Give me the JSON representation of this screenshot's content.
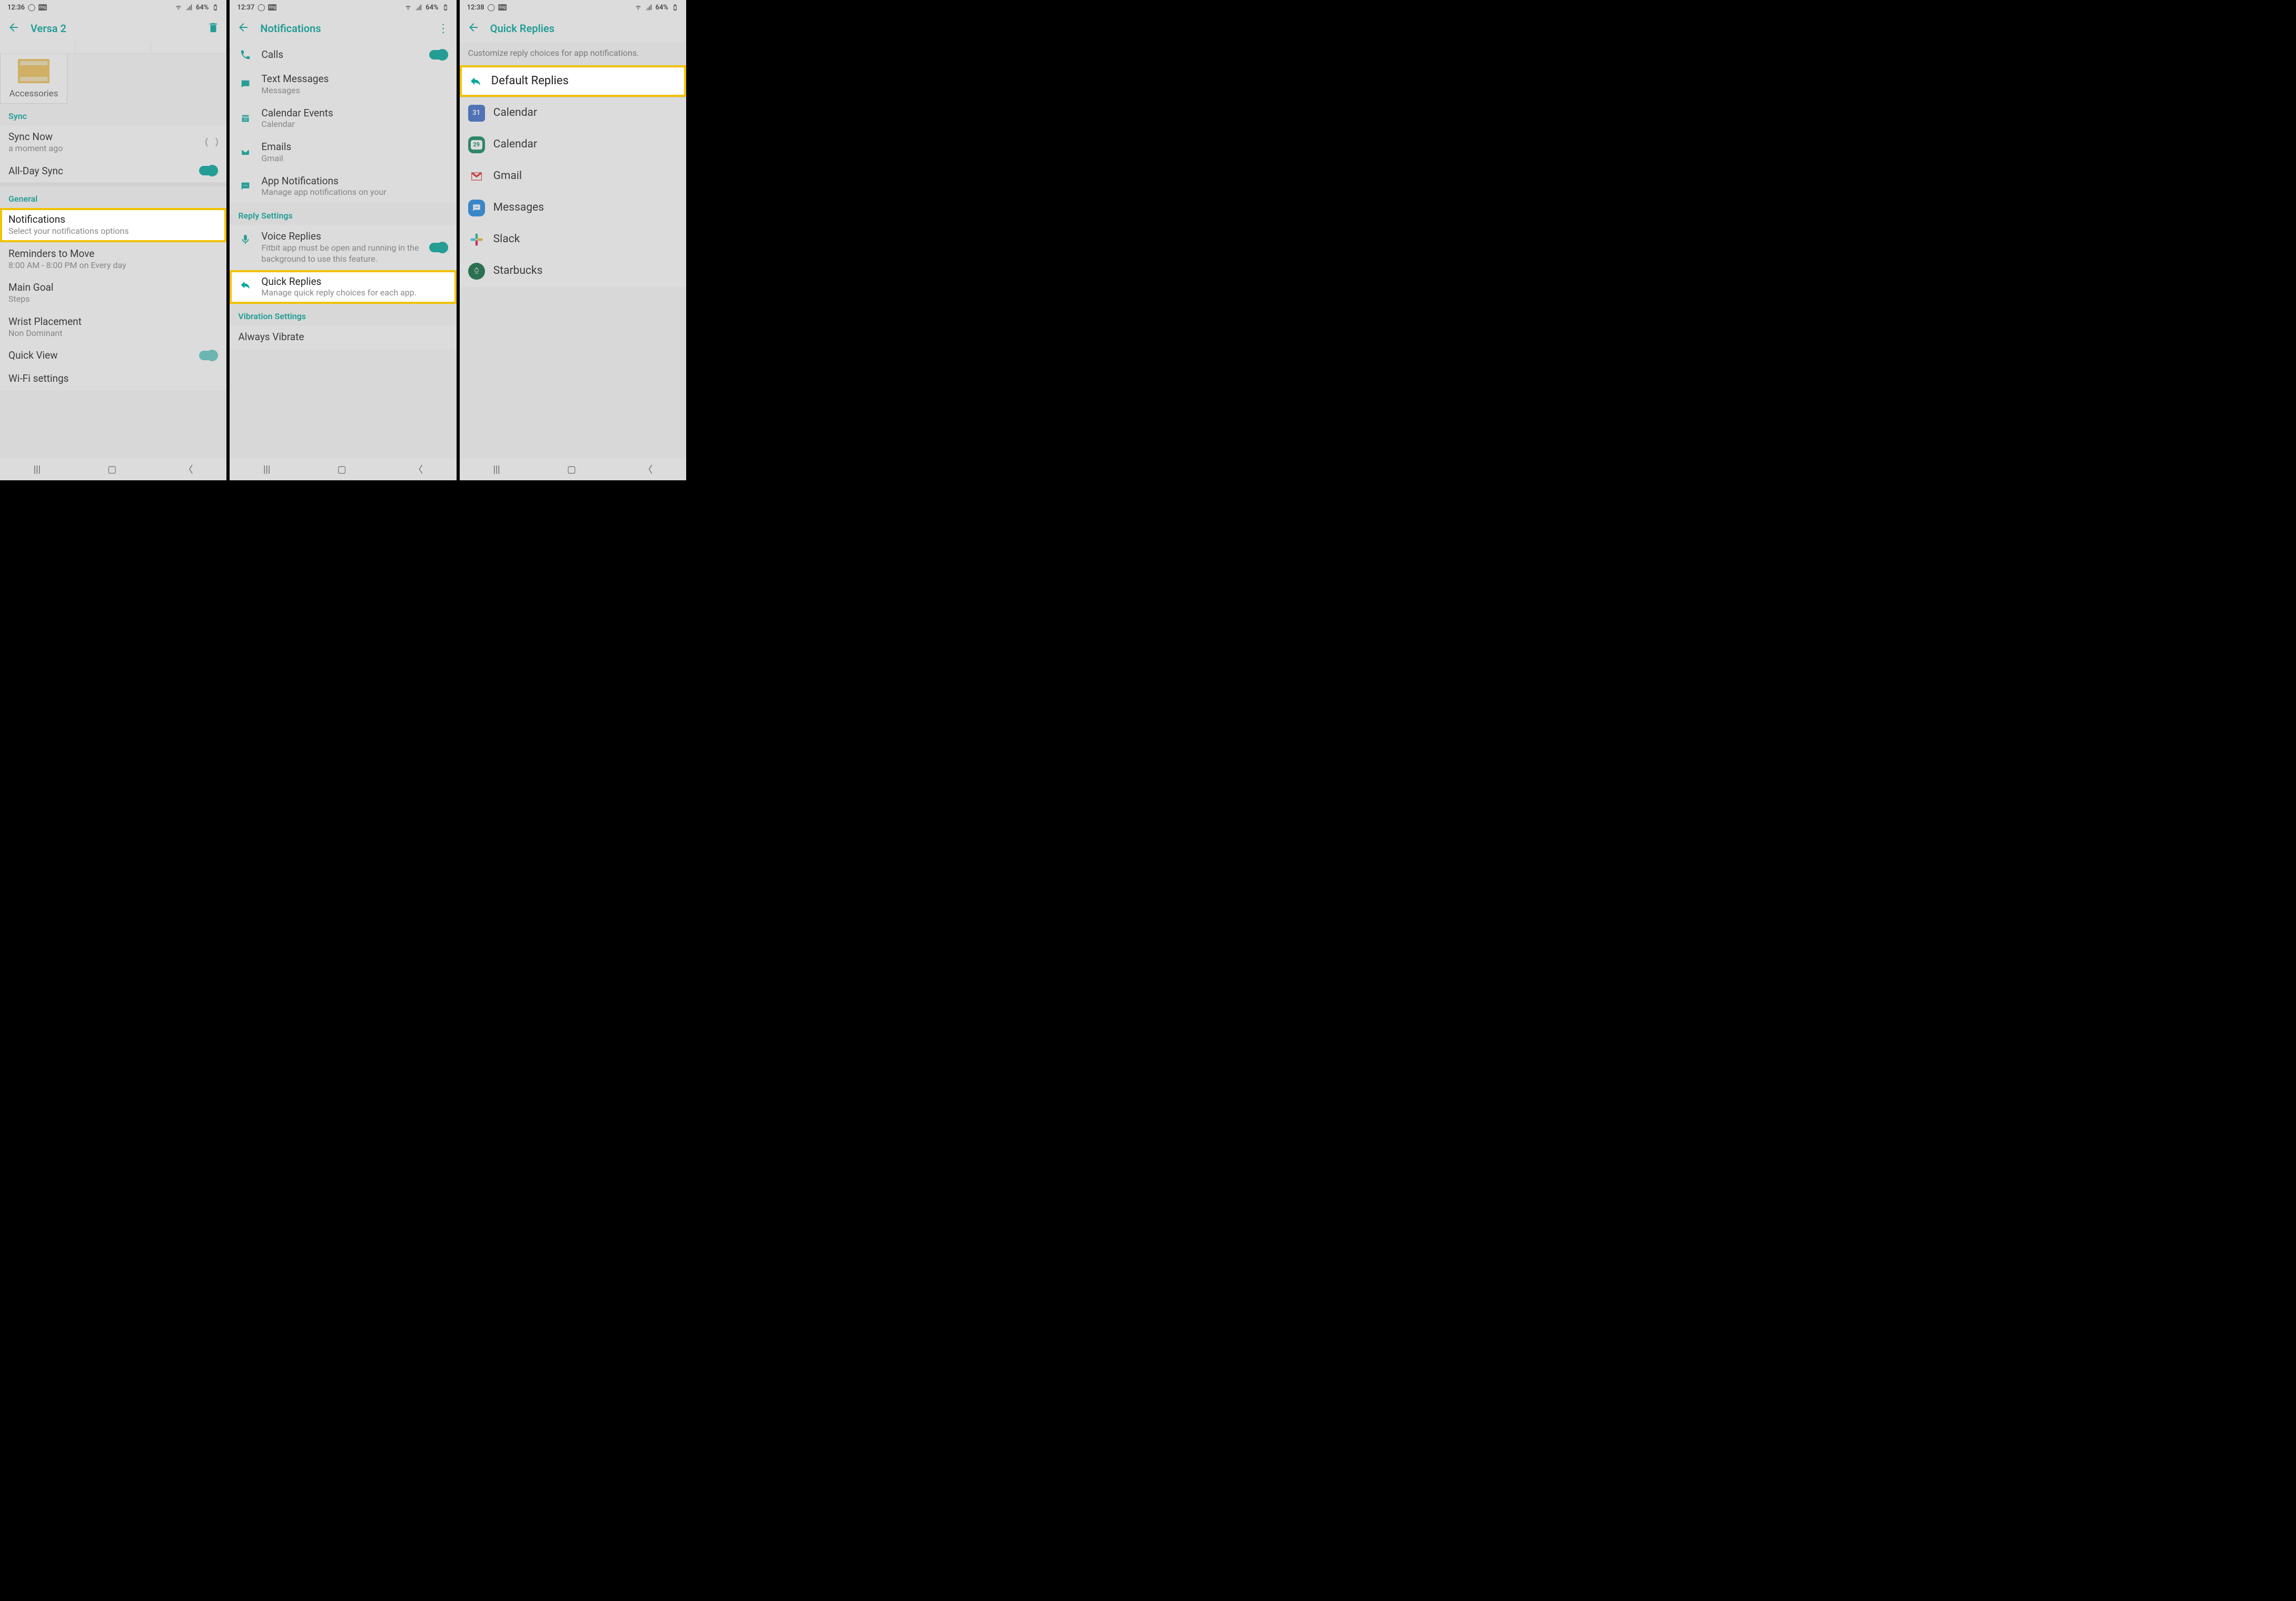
{
  "screens": [
    {
      "status": {
        "time": "12:36",
        "battery": "64%"
      },
      "title": "Versa 2",
      "accessories_label": "Accessories",
      "sections": {
        "sync": {
          "header": "Sync",
          "sync_now": "Sync Now",
          "sync_sub": "a moment ago",
          "allday": "All-Day Sync"
        },
        "general": {
          "header": "General",
          "items": [
            {
              "label": "Notifications",
              "sub": "Select your notifications options",
              "highlight": true
            },
            {
              "label": "Reminders to Move",
              "sub": "8:00 AM - 8:00 PM on Every day"
            },
            {
              "label": "Main Goal",
              "sub": "Steps"
            },
            {
              "label": "Wrist Placement",
              "sub": "Non Dominant"
            },
            {
              "label": "Quick View",
              "toggle": true
            },
            {
              "label": "Wi-Fi settings"
            }
          ]
        }
      }
    },
    {
      "status": {
        "time": "12:37",
        "battery": "64%"
      },
      "title": "Notifications",
      "notif_items": [
        {
          "label": "Calls",
          "toggle": true,
          "icon": "phone"
        },
        {
          "label": "Text Messages",
          "sub": "Messages",
          "icon": "message-rect"
        },
        {
          "label": "Calendar Events",
          "sub": "Calendar",
          "icon": "calendar"
        },
        {
          "label": "Emails",
          "sub": "Gmail",
          "icon": "envelope"
        },
        {
          "label": "App Notifications",
          "sub": "Manage app notifications on your",
          "icon": "chat"
        }
      ],
      "reply_header": "Reply Settings",
      "voice": {
        "label": "Voice Replies",
        "sub": "Fitbit app must be open and running in the background to use this feature.",
        "toggle": true
      },
      "quick": {
        "label": "Quick Replies",
        "sub": "Manage quick reply choices for each app.",
        "highlight": true
      },
      "vibration_header": "Vibration Settings",
      "always_vibrate": "Always Vibrate"
    },
    {
      "status": {
        "time": "12:38",
        "battery": "64%"
      },
      "title": "Quick Replies",
      "intro": "Customize reply choices for app notifications.",
      "default_replies": "Default Replies",
      "apps": [
        {
          "label": "Calendar",
          "icon": "cal-google"
        },
        {
          "label": "Calendar",
          "icon": "cal-samsung"
        },
        {
          "label": "Gmail",
          "icon": "gmail"
        },
        {
          "label": "Messages",
          "icon": "msg-blue"
        },
        {
          "label": "Slack",
          "icon": "slack"
        },
        {
          "label": "Starbucks",
          "icon": "starbucks"
        }
      ]
    }
  ]
}
